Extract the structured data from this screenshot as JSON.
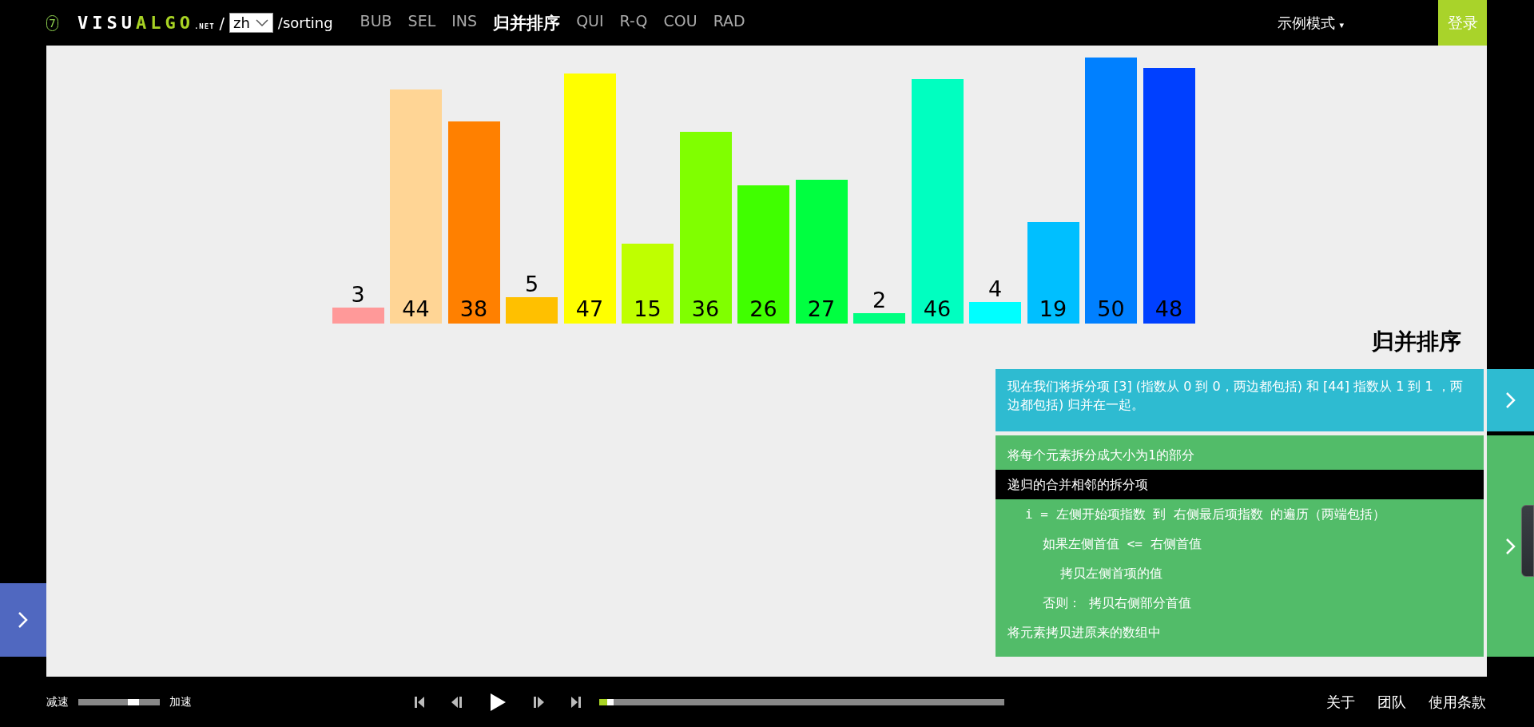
{
  "topbar": {
    "logo_badge": "7",
    "logo_main": "VISU",
    "logo_accent": "ALGO",
    "logo_suffix": ".NET",
    "separator": "/",
    "language": "zh",
    "path": "/sorting",
    "nav": [
      {
        "label": "BUB",
        "selected": false
      },
      {
        "label": "SEL",
        "selected": false
      },
      {
        "label": "INS",
        "selected": false
      },
      {
        "label": "归并排序",
        "selected": true
      },
      {
        "label": "QUI",
        "selected": false
      },
      {
        "label": "R-Q",
        "selected": false
      },
      {
        "label": "COU",
        "selected": false
      },
      {
        "label": "RAD",
        "selected": false
      }
    ],
    "mode_menu": "示例模式",
    "mode_caret": "▾",
    "login": "登录"
  },
  "array": [
    {
      "value": "3",
      "color": "#ff9999"
    },
    {
      "value": "44",
      "color": "#ffd595"
    },
    {
      "value": "38",
      "color": "#ff8000"
    },
    {
      "value": "5",
      "color": "#ffc000"
    },
    {
      "value": "47",
      "color": "#ffff00"
    },
    {
      "value": "15",
      "color": "#bfff00"
    },
    {
      "value": "36",
      "color": "#80ff00"
    },
    {
      "value": "26",
      "color": "#40ff00"
    },
    {
      "value": "27",
      "color": "#00ff40"
    },
    {
      "value": "2",
      "color": "#00ff80"
    },
    {
      "value": "46",
      "color": "#00ffc0"
    },
    {
      "value": "4",
      "color": "#00ffff"
    },
    {
      "value": "19",
      "color": "#00bfff"
    },
    {
      "value": "50",
      "color": "#0080ff"
    },
    {
      "value": "48",
      "color": "#0040ff"
    }
  ],
  "title": "归并排序",
  "description": "现在我们将拆分项 [3] (指数从 0 到 0，两边都包括) 和 [44] 指数从 1 到 1 ，两边都包括) 归并在一起。",
  "code": [
    {
      "line": "将每个元素拆分成大小为1的部分",
      "selected": false
    },
    {
      "line": "递归的合并相邻的拆分项",
      "selected": true,
      "children": [
        {
          "line": "i = 左侧开始项指数 到 右侧最后项指数 的遍历（两端包括）",
          "selected": false,
          "children": [
            {
              "line": "如果左侧首值 <= 右侧首值",
              "selected": false,
              "children": [
                {
                  "line": "拷贝左侧首项的值",
                  "selected": false
                }
              ]
            },
            {
              "line": "否则： 拷贝右侧部分首值",
              "selected": false
            }
          ]
        }
      ]
    },
    {
      "line": "将元素拷贝进原来的数组中",
      "selected": false
    }
  ],
  "controls": {
    "slower": "减速",
    "faster": "加速",
    "speed": {
      "level": 0.68
    },
    "progress": {
      "level": 0.02
    }
  },
  "footer": [
    "关于",
    "团队",
    "使用条款"
  ]
}
